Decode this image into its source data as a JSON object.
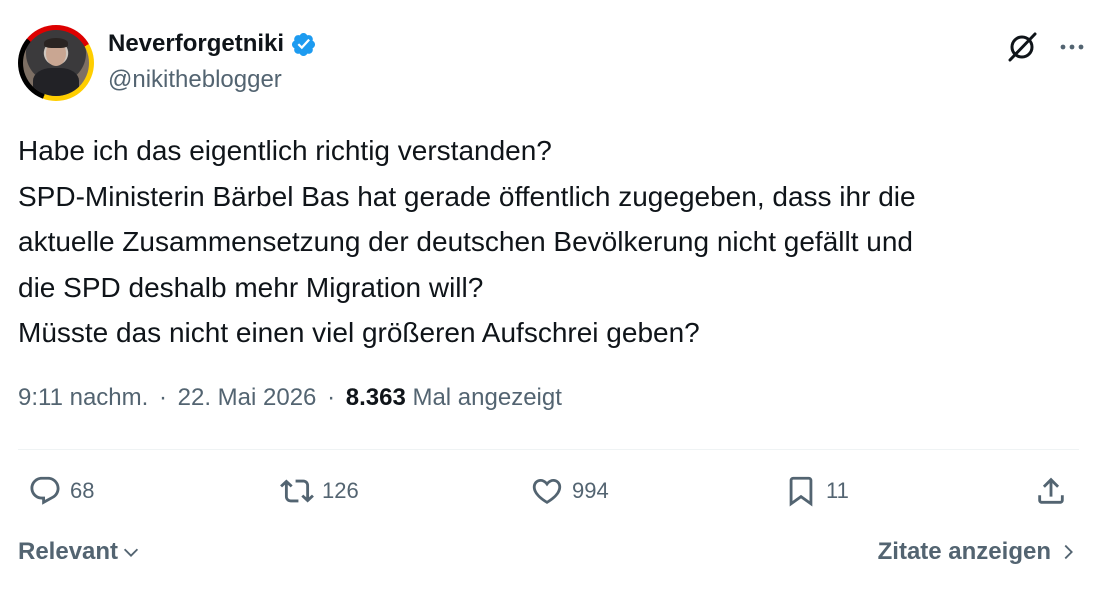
{
  "author": {
    "display_name": "Neverforgetniki",
    "handle": "@nikitheblogger",
    "verified": true,
    "verified_color": "#1d9bf0"
  },
  "header_icons": {
    "grok": "grok-icon",
    "more": "more-icon"
  },
  "tweet": {
    "lines": [
      "Habe ich das eigentlich richtig verstanden?",
      "SPD-Ministerin Bärbel Bas hat gerade öffentlich zugegeben, dass ihr die",
      "aktuelle Zusammensetzung der deutschen Bevölkerung nicht gefällt und",
      "die SPD deshalb mehr Migration will?",
      "Müsste das nicht einen viel größeren Aufschrei geben?"
    ]
  },
  "meta": {
    "time": "9:11 nachm.",
    "separator": "·",
    "date": "22. Mai 2026",
    "views_count": "8.363",
    "views_label": "Mal angezeigt"
  },
  "actions": {
    "reply": {
      "icon": "reply-icon",
      "count": "68"
    },
    "retweet": {
      "icon": "retweet-icon",
      "count": "126"
    },
    "like": {
      "icon": "heart-icon",
      "count": "994"
    },
    "bookmark": {
      "icon": "bookmark-icon",
      "count": "11"
    },
    "share": {
      "icon": "share-icon"
    }
  },
  "footer": {
    "sort_label": "Relevant",
    "quotes_label": "Zitate anzeigen"
  },
  "colors": {
    "text_primary": "#0f1419",
    "text_secondary": "#536471",
    "divider": "#eff3f4",
    "accent": "#1d9bf0"
  }
}
